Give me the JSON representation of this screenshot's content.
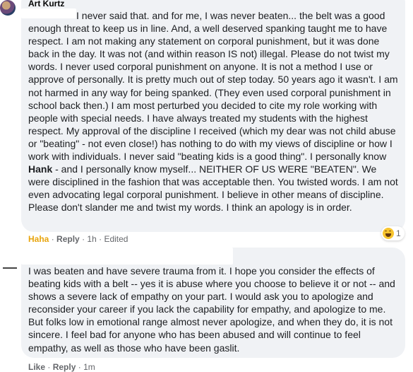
{
  "comment1": {
    "author": "Art Kurtz",
    "text": "I never said that. and for me, I was never beaten... the belt was a good enough threat to keep us in line. And, a well deserved spanking taught me to have respect. I am not making any statement on corporal punishment, but it was done back in the day. It was not (and within reason IS not) illegal. Please do not twist my words. I never used corporal punishment on anyone. It is not a method I use or approve of personally. It is pretty much out of step today. 50 years ago it wasn't. I am not harmed in any way for being spanked. (They even used corporal punishment in school back then.) I am most perturbed you decided to cite my role working with people with special needs. I have always treated my students with the highest respect. My approval of the discipline I received (which my dear was not child abuse or \"beating\" - not even close!) has nothing to do with my views of discipline or how I work with individuals. I never said \"beating kids is a good thing\". I personally know ",
    "mention": "Hank",
    "text_after": " - and I personally know myself... NEITHER OF US WERE \"BEATEN\". We were disciplined in the fashion that was acceptable then. You twisted words. I am not even advocating legal corporal punishment. I believe in other means of discipline. Please don't slander me and twist my words. I think an apology is in order.",
    "actions": {
      "reaction": "Haha",
      "reply": "Reply",
      "time": "1h",
      "edited": "Edited"
    },
    "reaction_count": "1",
    "reaction_icon": "haha-emoji-icon"
  },
  "comment2": {
    "text": "I was beaten and have severe trauma from it. I hope you consider the effects of beating kids with a belt -- yes it is abuse where you choose to believe it or not -- and shows a severe lack of empathy on your part. I would ask you to apologize and reconsider your career if you lack the capability for empathy, and apologize to me. But folks low in emotional range almost never apologize, and when they do, it is not sincere. I feel bad for anyone who has been abused and will continue to feel empathy, as well as those who have been gaslit.",
    "actions": {
      "like": "Like",
      "reply": "Reply",
      "time": "1m"
    }
  },
  "separator": "·"
}
